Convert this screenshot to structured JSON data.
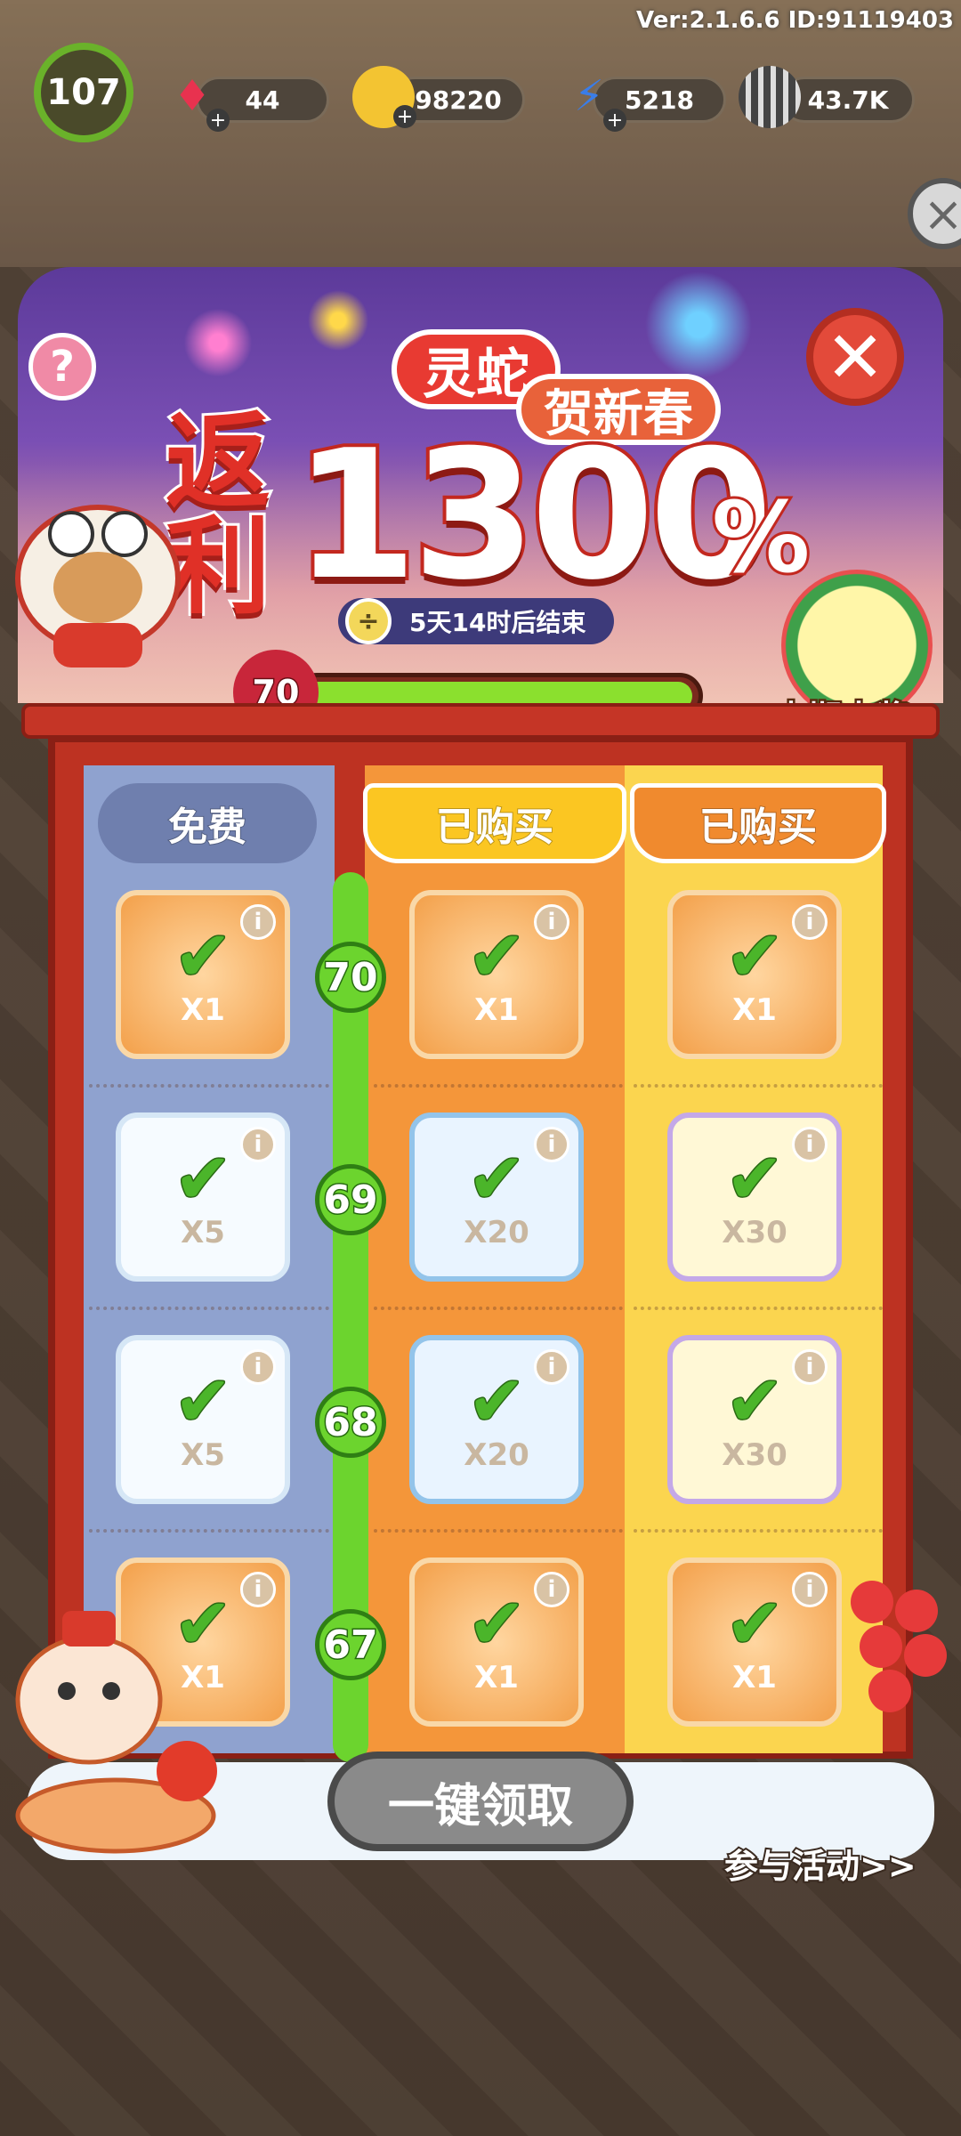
{
  "version_text": "Ver:2.1.6.6 ID:91119403",
  "player": {
    "level": "107"
  },
  "resources": [
    {
      "name": "gem",
      "value": "44"
    },
    {
      "name": "coin",
      "value": "98220"
    },
    {
      "name": "energy",
      "value": "5218"
    },
    {
      "name": "seed",
      "value": "43.7K"
    }
  ],
  "banner": {
    "title_line1": "灵蛇",
    "title_line2": "贺新春",
    "title_big1": "返利",
    "title_big2": "1300",
    "title_pct": "%",
    "timer": "5天14时后结束",
    "grand_prize_label": "本期大奖"
  },
  "progress": {
    "level": "70",
    "fill_fraction": 1.0
  },
  "columns": [
    {
      "key": "free",
      "label": "免费"
    },
    {
      "key": "paid1",
      "label": "已购买"
    },
    {
      "key": "paid2",
      "label": "已购买"
    }
  ],
  "rows": [
    {
      "level": "70",
      "rewards": [
        {
          "style": "gold",
          "qty": "X1",
          "claimed": true
        },
        {
          "style": "gold",
          "qty": "X1",
          "claimed": true
        },
        {
          "style": "gold",
          "qty": "X1",
          "claimed": true
        }
      ]
    },
    {
      "level": "69",
      "rewards": [
        {
          "style": "white",
          "qty": "X5",
          "claimed": true
        },
        {
          "style": "blue",
          "qty": "X20",
          "claimed": true
        },
        {
          "style": "purple",
          "qty": "X30",
          "claimed": true
        }
      ]
    },
    {
      "level": "68",
      "rewards": [
        {
          "style": "white",
          "qty": "X5",
          "claimed": true
        },
        {
          "style": "blue",
          "qty": "X20",
          "claimed": true
        },
        {
          "style": "purple",
          "qty": "X30",
          "claimed": true
        }
      ]
    },
    {
      "level": "67",
      "rewards": [
        {
          "style": "gold",
          "qty": "X1",
          "claimed": true
        },
        {
          "style": "gold",
          "qty": "X1",
          "claimed": true
        },
        {
          "style": "gold",
          "qty": "X1",
          "claimed": true
        }
      ]
    }
  ],
  "icons": {
    "check": "checkmark-icon",
    "info": "info-icon",
    "close": "close-icon",
    "help": "question-icon",
    "timer": "clock-icon"
  },
  "bottom": {
    "claim_all": "一键领取",
    "join_link": "参与活动>>"
  },
  "colors": {
    "accent_red": "#c53526",
    "progress_green": "#8be02e",
    "free_col": "#8fa2cf",
    "paid1_col": "#f4963a",
    "paid2_col": "#fbd54f"
  }
}
